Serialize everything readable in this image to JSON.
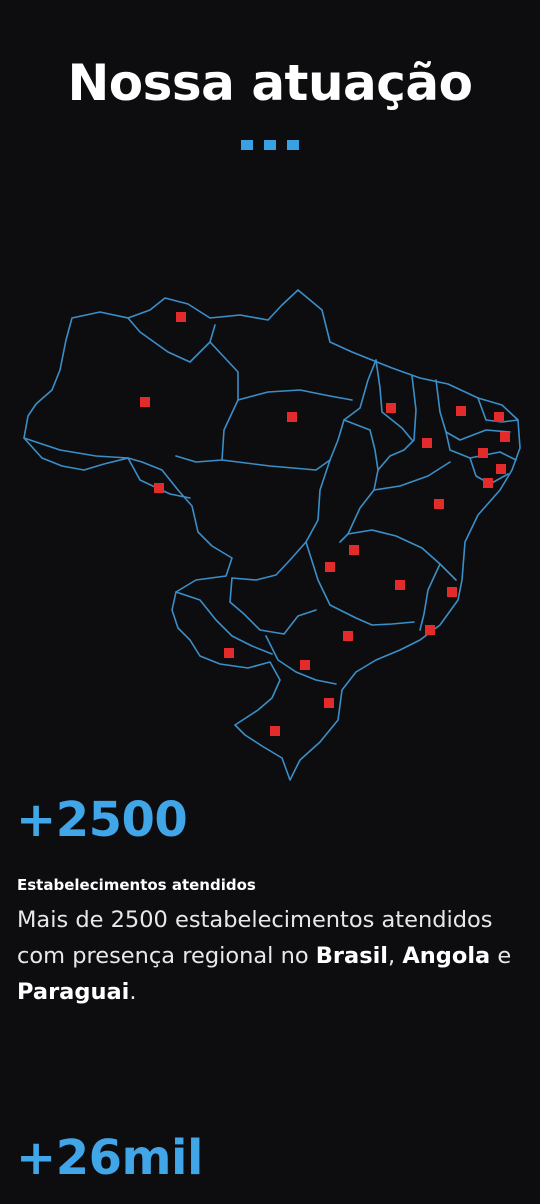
{
  "section": {
    "title": "Nossa atuação"
  },
  "colors": {
    "background": "#0d0d0f",
    "accent": "#41a6e8",
    "map_outline": "#3b8fc8",
    "marker": "#e32b2b"
  },
  "map": {
    "icon": "brazil-states-map",
    "marker_count": 27
  },
  "stats": [
    {
      "value": "+2500",
      "label": "Estabelecimentos atendidos",
      "desc_start": "Mais de 2500 estabelecimentos atendidos com presença regional no",
      "country_1": "Brasil",
      "sep_1": ",",
      "country_2": "Angola",
      "sep_2": "e",
      "country_3": "Paraguai",
      "end": "."
    },
    {
      "value": "+26mil"
    }
  ]
}
